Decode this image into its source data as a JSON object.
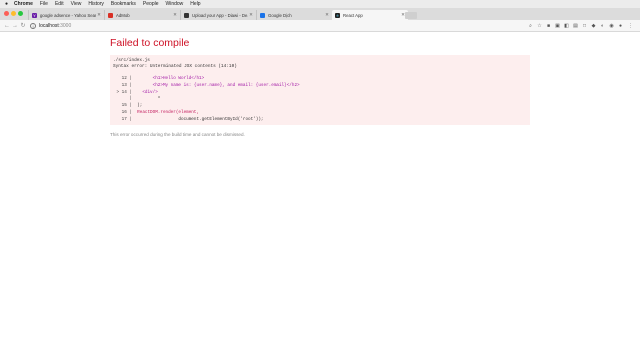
{
  "menubar": {
    "app": "Chrome",
    "items": [
      "File",
      "Edit",
      "View",
      "History",
      "Bookmarks",
      "People",
      "Window",
      "Help"
    ]
  },
  "tabs": [
    {
      "label": "google adsence - Yahoo Sear...",
      "favicon_color": "#6b21a8"
    },
    {
      "label": "AdMob",
      "favicon_color": "#d93025"
    },
    {
      "label": "Upload your App - Diawi - De...",
      "favicon_color": "#333333"
    },
    {
      "label": "Google Dịch",
      "favicon_color": "#1a73e8"
    },
    {
      "label": "React App",
      "favicon_color": "#222222"
    }
  ],
  "toolbar": {
    "url_host": "localhost",
    "url_port": ":3000"
  },
  "error": {
    "title": "Failed to compile",
    "file": "./src/index.js",
    "message": "Syntax error: Unterminated JSX contents (14:10)",
    "code": [
      {
        "gutter": "  12 |",
        "text": "        <h1>Hello World</h1>"
      },
      {
        "gutter": "  13 |",
        "text": "        <h2>My name is: {user.name}, and email: {user.email}</h2>"
      },
      {
        "gutter": "> 14 |",
        "text": "    <div/>"
      },
      {
        "gutter": "     |",
        "text": "          ^"
      },
      {
        "gutter": "  15 |",
        "text": "  );"
      },
      {
        "gutter": "  16 |",
        "text": "  ReactDOM.render(element,"
      },
      {
        "gutter": "  17 |",
        "text": "                  document.getElementById('root'));"
      }
    ],
    "footnote": "This error occurred during the build time and cannot be dismissed."
  },
  "colors": {
    "error_red": "#ce1126",
    "error_bg": "#fdeeee"
  }
}
